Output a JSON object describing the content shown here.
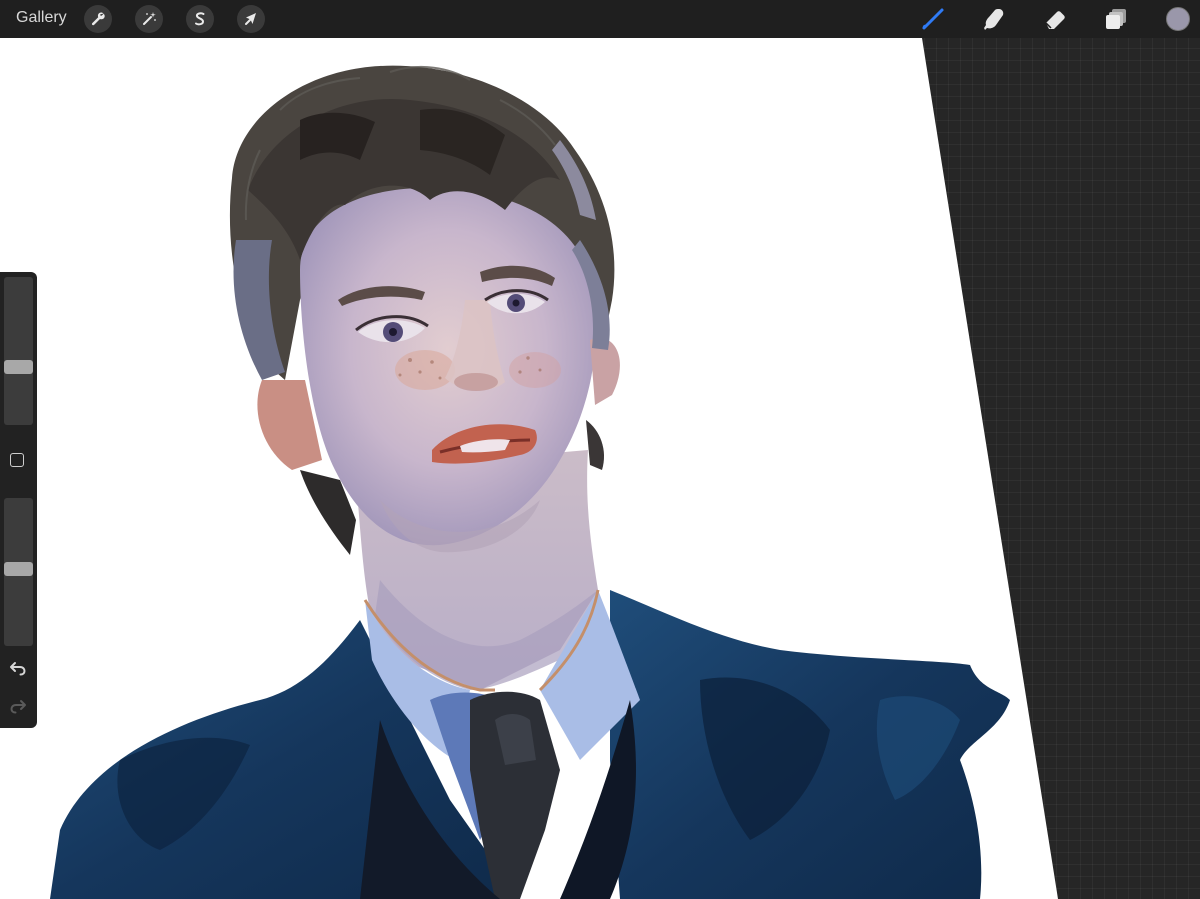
{
  "topbar": {
    "gallery_label": "Gallery",
    "actions": [
      {
        "name": "actions-button",
        "icon": "wrench-icon"
      },
      {
        "name": "adjustments-button",
        "icon": "magic-wand-icon"
      },
      {
        "name": "selection-button",
        "icon": "selection-s-icon"
      },
      {
        "name": "transform-button",
        "icon": "arrow-cursor-icon"
      }
    ],
    "tools": [
      {
        "name": "brush-tool-button",
        "icon": "paintbrush-icon",
        "active": true
      },
      {
        "name": "smudge-tool-button",
        "icon": "smudge-finger-icon",
        "active": false
      },
      {
        "name": "eraser-tool-button",
        "icon": "eraser-icon",
        "active": false
      },
      {
        "name": "layers-button",
        "icon": "layers-icon",
        "active": false
      }
    ],
    "current_color": "#9a97aa",
    "accent_color": "#2f7bf5"
  },
  "sidebar": {
    "brush_size_level": 0.62,
    "opacity_level": 0.48,
    "modify_button_icon": "square-icon",
    "undo_icon": "undo-arrow-icon",
    "redo_icon": "redo-arrow-icon",
    "redo_enabled": false
  },
  "canvas": {
    "paper_color": "#ffffff",
    "background_color": "#262626",
    "artwork": "painted-portrait"
  }
}
